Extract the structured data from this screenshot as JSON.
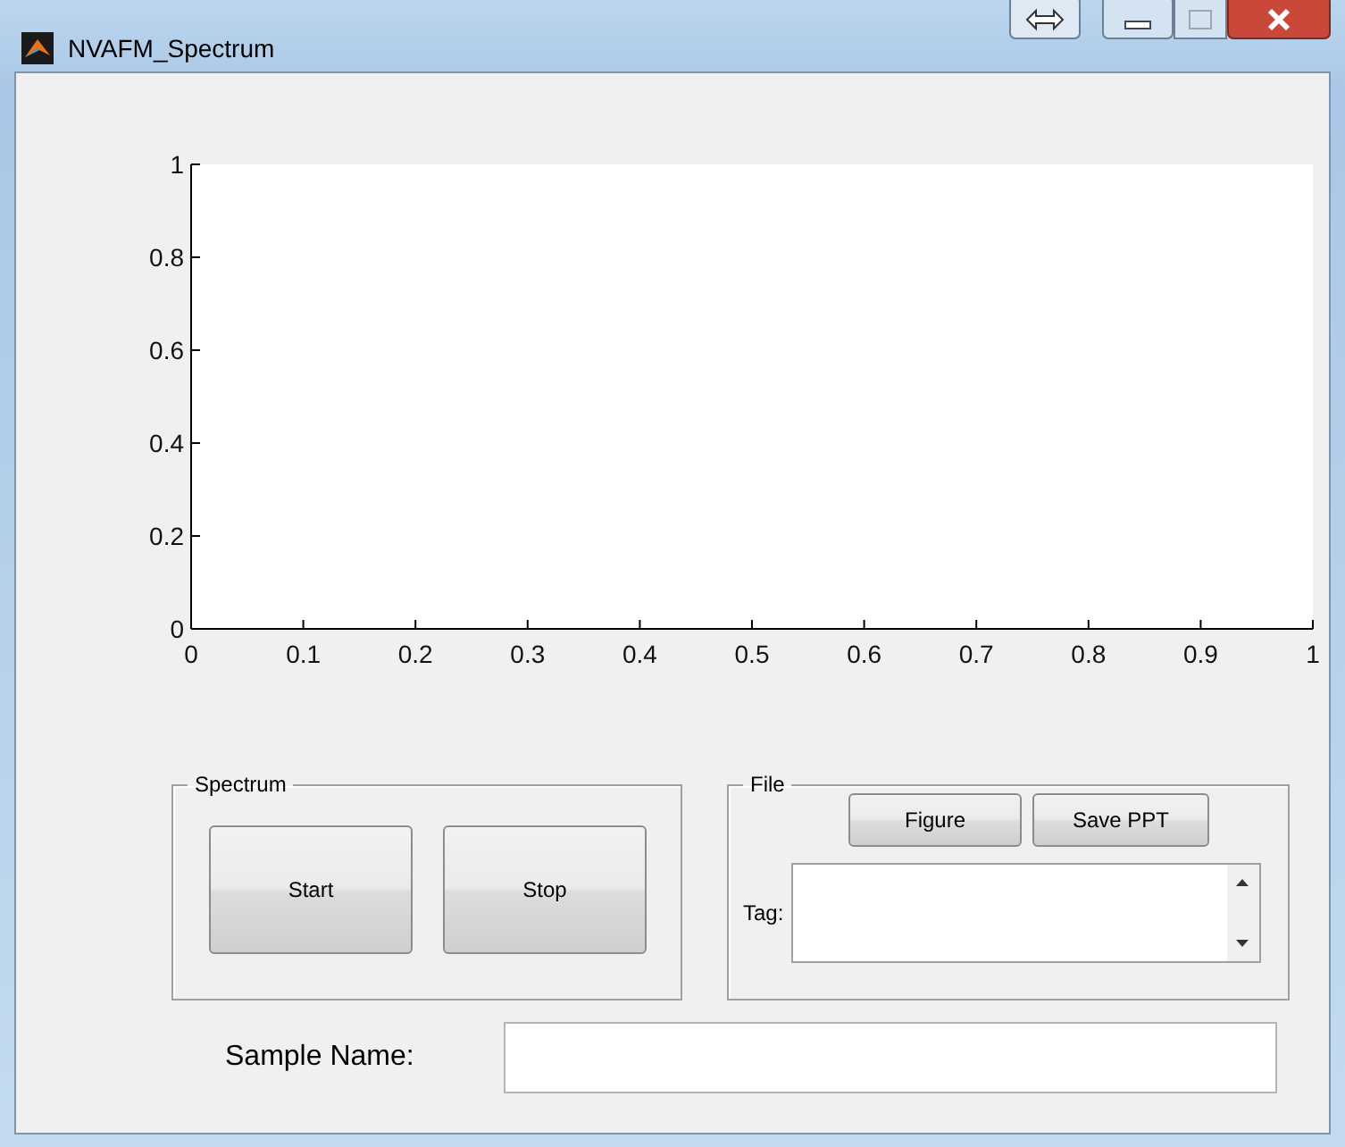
{
  "window": {
    "title": "NVAFM_Spectrum"
  },
  "chart": {
    "chart_data": {
      "type": "line",
      "xlim": [
        0,
        1
      ],
      "ylim": [
        0,
        1
      ],
      "xticks": [
        {
          "value": 0,
          "label": "0"
        },
        {
          "value": 0.1,
          "label": "0.1"
        },
        {
          "value": 0.2,
          "label": "0.2"
        },
        {
          "value": 0.3,
          "label": "0.3"
        },
        {
          "value": 0.4,
          "label": "0.4"
        },
        {
          "value": 0.5,
          "label": "0.5"
        },
        {
          "value": 0.6,
          "label": "0.6"
        },
        {
          "value": 0.7,
          "label": "0.7"
        },
        {
          "value": 0.8,
          "label": "0.8"
        },
        {
          "value": 0.9,
          "label": "0.9"
        },
        {
          "value": 1,
          "label": "1"
        }
      ],
      "yticks": [
        {
          "value": 0,
          "label": "0"
        },
        {
          "value": 0.2,
          "label": "0.2"
        },
        {
          "value": 0.4,
          "label": "0.4"
        },
        {
          "value": 0.6,
          "label": "0.6"
        },
        {
          "value": 0.8,
          "label": "0.8"
        },
        {
          "value": 1,
          "label": "1"
        }
      ]
    }
  },
  "spectrum_panel": {
    "title": "Spectrum",
    "buttons": [
      "Start",
      "Stop"
    ]
  },
  "file_panel": {
    "title": "File",
    "buttons": [
      "Figure",
      "Save PPT"
    ],
    "tag_label": "Tag:"
  },
  "sample_name": {
    "label": "Sample Name:"
  }
}
